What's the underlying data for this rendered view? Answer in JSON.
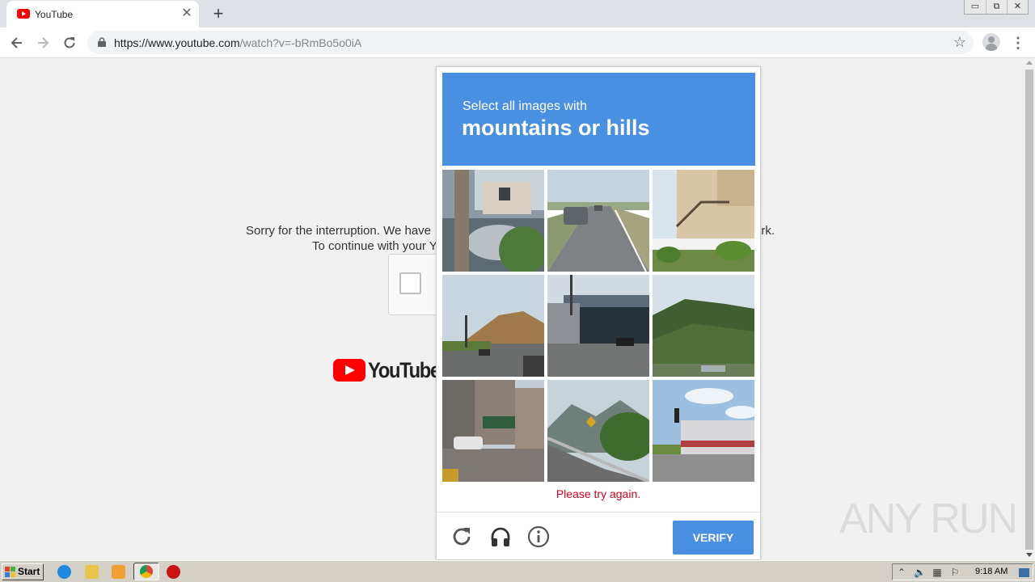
{
  "browser": {
    "tab_title": "YouTube",
    "new_tab_label": "+",
    "url_host": "https://www.youtube.com",
    "url_path": "/watch?v=-bRmBo5o0iA",
    "window_controls": [
      "▭",
      "⧉",
      "✕"
    ]
  },
  "page": {
    "sorry_line1": "Sorry for the interruption. We have",
    "sorry_line1_end": "ork.",
    "sorry_line2": "To continue with your Y",
    "logo_text": "YouTube"
  },
  "captcha": {
    "instruction": "Select all images with",
    "target": "mountains or hills",
    "error": "Please try again.",
    "verify_label": "VERIFY",
    "footer_icons": [
      "reload-icon",
      "audio-icon",
      "info-icon"
    ],
    "colors": {
      "header": "#4a90e2",
      "error": "#d0021b"
    }
  },
  "watermark": "ANY RUN",
  "taskbar": {
    "start_label": "Start",
    "clock": "9:18 AM"
  }
}
